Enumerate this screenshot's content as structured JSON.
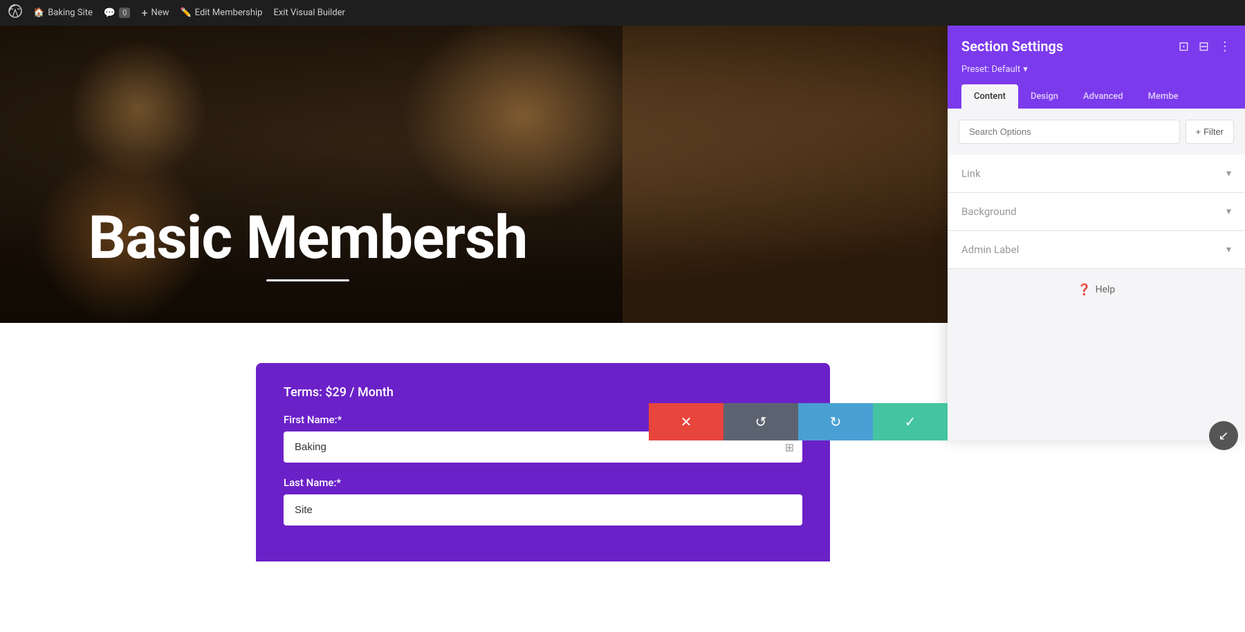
{
  "adminBar": {
    "wp_logo": "⊞",
    "site_name": "Baking Site",
    "comments_label": "0",
    "new_label": "New",
    "edit_label": "Edit Membership",
    "exit_label": "Exit Visual Builder"
  },
  "hero": {
    "title": "Basic Membersh",
    "underline": true
  },
  "settingsPanel": {
    "title": "Section Settings",
    "preset_label": "Preset: Default",
    "preset_arrow": "▾",
    "tabs": [
      {
        "id": "content",
        "label": "Content",
        "active": true
      },
      {
        "id": "design",
        "label": "Design",
        "active": false
      },
      {
        "id": "advanced",
        "label": "Advanced",
        "active": false
      },
      {
        "id": "member",
        "label": "Membe",
        "active": false
      }
    ],
    "search_placeholder": "Search Options",
    "filter_label": "+ Filter",
    "accordions": [
      {
        "id": "link",
        "label": "Link"
      },
      {
        "id": "background",
        "label": "Background"
      },
      {
        "id": "admin_label",
        "label": "Admin Label"
      }
    ],
    "help_label": "Help"
  },
  "formSection": {
    "terms_label": "Terms: $29 / Month",
    "first_name_label": "First Name:*",
    "first_name_value": "Baking",
    "last_name_label": "Last Name:*",
    "last_name_value": "Site"
  },
  "actionButtons": {
    "cancel_icon": "✕",
    "undo_icon": "↺",
    "redo_icon": "↻",
    "save_icon": "✓"
  },
  "floatingBtn": {
    "icon": "↙"
  }
}
